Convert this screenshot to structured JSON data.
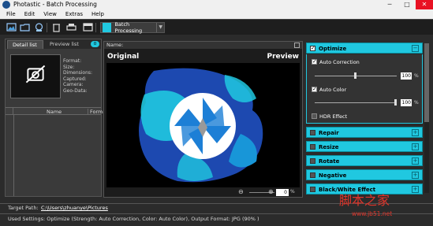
{
  "window": {
    "title": "Photastic - Batch Processing"
  },
  "menu": [
    "File",
    "Edit",
    "View",
    "Extras",
    "Help"
  ],
  "toolbar": {
    "batch_label": "Batch Processing"
  },
  "left_panel": {
    "tabs": [
      "Detail list",
      "Preview list"
    ],
    "tab_count": "0",
    "meta_labels": [
      "Format:",
      "Size:",
      "Dimensions:",
      "Captured:",
      "Camera:",
      "Geo-Data:"
    ],
    "columns": [
      "Name",
      "Format"
    ]
  },
  "center": {
    "name_label": "Name:",
    "original_label": "Original",
    "preview_label": "Preview",
    "zoom_value": "0",
    "zoom_unit": "%"
  },
  "right_panel": {
    "sections": [
      {
        "label": "Optimize",
        "checked": true,
        "expanded": true
      },
      {
        "label": "Repair",
        "checked": false
      },
      {
        "label": "Resize",
        "checked": false
      },
      {
        "label": "Rotate",
        "checked": false
      },
      {
        "label": "Negative",
        "checked": false
      },
      {
        "label": "Black/White Effect",
        "checked": false
      }
    ],
    "optimize": {
      "auto_correction_label": "Auto Correction",
      "auto_correction_value": "100",
      "auto_color_label": "Auto Color",
      "auto_color_value": "100",
      "hdr_label": "HDR Effect",
      "unit": "%"
    }
  },
  "bottom": {
    "target_label": "Target Path:",
    "target_path": "C:\\Users\\zhuanye\\Pictures",
    "status": "Used Settings: Optimize (Strength: Auto Correction, Color: Auto Color), Output Format: JPG (90% )"
  },
  "watermark": {
    "text": "脚本之家",
    "url": "www.jb51.net"
  }
}
